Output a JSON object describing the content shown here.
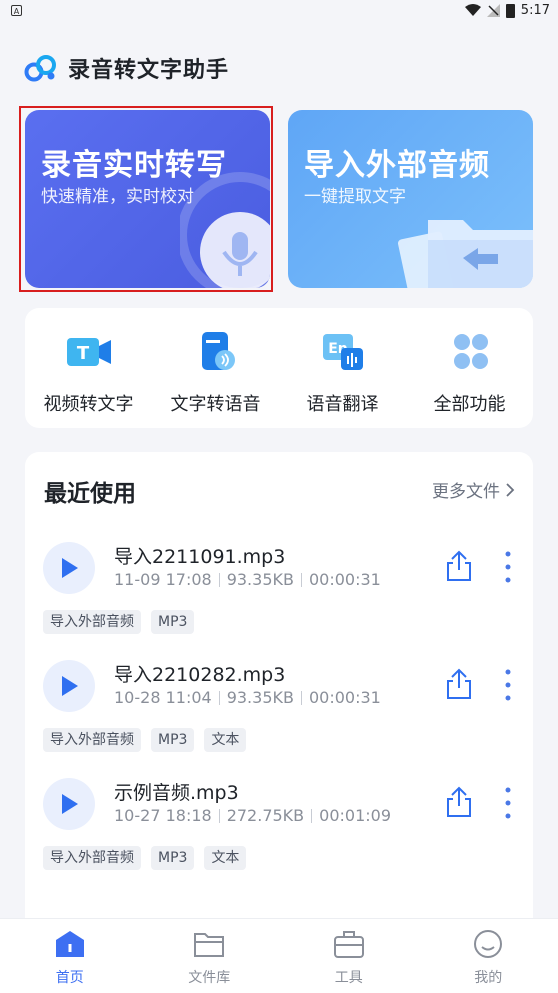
{
  "status_bar": {
    "time": "5:17"
  },
  "header": {
    "app_title": "录音转文字助手"
  },
  "hero": {
    "record": {
      "title": "录音实时转写",
      "subtitle": "快速精准，实时校对"
    },
    "import": {
      "title": "导入外部音频",
      "subtitle": "一键提取文字"
    }
  },
  "features": [
    {
      "label": "视频转文字",
      "icon": "video-to-text-icon"
    },
    {
      "label": "文字转语音",
      "icon": "text-to-speech-icon"
    },
    {
      "label": "语音翻译",
      "icon": "voice-translate-icon"
    },
    {
      "label": "全部功能",
      "icon": "all-features-icon"
    }
  ],
  "recent": {
    "title": "最近使用",
    "more_label": "更多文件",
    "files": [
      {
        "name": "导入2211091.mp3",
        "date": "11-09 17:08",
        "size": "93.35KB",
        "duration": "00:00:31",
        "tags": [
          "导入外部音频",
          "MP3"
        ]
      },
      {
        "name": "导入2210282.mp3",
        "date": "10-28 11:04",
        "size": "93.35KB",
        "duration": "00:00:31",
        "tags": [
          "导入外部音频",
          "MP3",
          "文本"
        ]
      },
      {
        "name": "示例音频.mp3",
        "date": "10-27 18:18",
        "size": "272.75KB",
        "duration": "00:01:09",
        "tags": [
          "导入外部音频",
          "MP3",
          "文本"
        ]
      }
    ]
  },
  "bottom_nav": [
    {
      "label": "首页",
      "icon": "home-icon",
      "active": true
    },
    {
      "label": "文件库",
      "icon": "folder-icon",
      "active": false
    },
    {
      "label": "工具",
      "icon": "toolbox-icon",
      "active": false
    },
    {
      "label": "我的",
      "icon": "profile-icon",
      "active": false
    }
  ],
  "colors": {
    "accent": "#3d6ff2",
    "hero_left": "#5a6ff0",
    "hero_right": "#6fb4f8",
    "focus_border": "#d81e1e"
  }
}
